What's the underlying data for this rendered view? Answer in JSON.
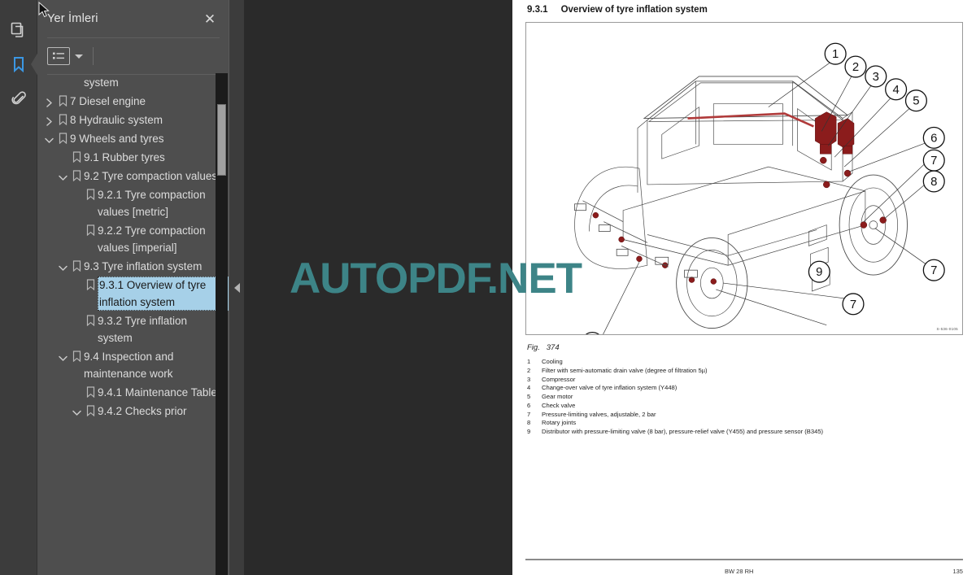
{
  "app": {
    "rail_icons": [
      {
        "name": "pages-thumbnails-icon",
        "label": "Sayfa Küçük Resimleri",
        "active": false
      },
      {
        "name": "bookmarks-icon",
        "label": "Yer İmleri",
        "active": true
      },
      {
        "name": "attachments-icon",
        "label": "Ekler",
        "active": false
      }
    ],
    "accent_blue": "#3b97e3",
    "panel_bg": "#4e4e4e",
    "viewer_bg": "#2a2a2a",
    "selection_bg": "#a6d0e8"
  },
  "panel": {
    "title": "Yer İmleri",
    "close_label": "✕",
    "toolbar": {
      "list_options_label": "Seçenekler",
      "dropdown_caret": "▾"
    }
  },
  "bookmarks": [
    {
      "id": "partial-top",
      "label": "system",
      "indent": 1,
      "twisty": "none",
      "has_icon": false,
      "selected": false
    },
    {
      "id": "7-diesel-engine",
      "label": "7 Diesel engine",
      "indent": 0,
      "twisty": "collapsed",
      "has_icon": true,
      "selected": false
    },
    {
      "id": "8-hydraulic-system",
      "label": "8 Hydraulic system",
      "indent": 0,
      "twisty": "collapsed",
      "has_icon": true,
      "selected": false
    },
    {
      "id": "9-wheels-and-tyres",
      "label": "9 Wheels and tyres",
      "indent": 0,
      "twisty": "expanded",
      "has_icon": true,
      "selected": false
    },
    {
      "id": "9-1-rubber-tyres",
      "label": "9.1 Rubber tyres",
      "indent": 1,
      "twisty": "none",
      "has_icon": true,
      "selected": false
    },
    {
      "id": "9-2-tyre-compaction-values",
      "label": "9.2 Tyre compaction values",
      "indent": 1,
      "twisty": "expanded",
      "has_icon": true,
      "selected": false
    },
    {
      "id": "9-2-1-tyre-compaction-values-metric",
      "label": "9.2.1 Tyre compaction values [metric]",
      "indent": 2,
      "twisty": "none",
      "has_icon": true,
      "selected": false
    },
    {
      "id": "9-2-2-tyre-compaction-values-imperial",
      "label": "9.2.2 Tyre compaction values [imperial]",
      "indent": 2,
      "twisty": "none",
      "has_icon": true,
      "selected": false
    },
    {
      "id": "9-3-tyre-inflation-system",
      "label": "9.3 Tyre inflation system",
      "indent": 1,
      "twisty": "expanded",
      "has_icon": true,
      "selected": false
    },
    {
      "id": "9-3-1-overview-of-tyre-inflation-system",
      "label": "9.3.1 Overview of tyre inflation system",
      "indent": 2,
      "twisty": "none",
      "has_icon": true,
      "selected": true
    },
    {
      "id": "9-3-2-tyre-inflation-system",
      "label": "9.3.2 Tyre inflation system",
      "indent": 2,
      "twisty": "none",
      "has_icon": true,
      "selected": false
    },
    {
      "id": "9-4-inspection-and-maintenance-work",
      "label": "9.4 Inspection and maintenance work",
      "indent": 1,
      "twisty": "expanded",
      "has_icon": true,
      "selected": false
    },
    {
      "id": "9-4-1-maintenance-table",
      "label": "9.4.1 Maintenance Table",
      "indent": 2,
      "twisty": "none",
      "has_icon": true,
      "selected": false
    },
    {
      "id": "9-4-2-checks-prior",
      "label": "9.4.2 Checks prior",
      "indent": 2,
      "twisty": "expanded",
      "has_icon": true,
      "selected": false
    }
  ],
  "document": {
    "section_number": "9.3.1",
    "section_title": "Overview of tyre inflation system",
    "figure": {
      "caption_label": "Fig.",
      "caption_number": "374",
      "drawing_code": "S-536-0105",
      "callouts": [
        "1",
        "2",
        "3",
        "4",
        "5",
        "6",
        "7",
        "8",
        "9"
      ]
    },
    "legend": [
      {
        "num": "1",
        "text": "Cooling"
      },
      {
        "num": "2",
        "text": "Filter with semi-automatic drain valve (degree of filtration 5µ)"
      },
      {
        "num": "3",
        "text": "Compressor"
      },
      {
        "num": "4",
        "text": "Change-over valve of tyre inflation system (Y448)"
      },
      {
        "num": "5",
        "text": "Gear motor"
      },
      {
        "num": "6",
        "text": "Check valve"
      },
      {
        "num": "7",
        "text": "Pressure-limiting valves, adjustable, 2 bar"
      },
      {
        "num": "8",
        "text": "Rotary joints"
      },
      {
        "num": "9",
        "text": "Distributor with pressure-limiting valve (8 bar), pressure-relief valve (Y455) and pressure sensor (B345)"
      }
    ],
    "footer": {
      "center": "BW 28 RH",
      "right": "135"
    }
  },
  "watermark": {
    "text": "AUTOPDF.NET",
    "color": "#3d8487"
  }
}
